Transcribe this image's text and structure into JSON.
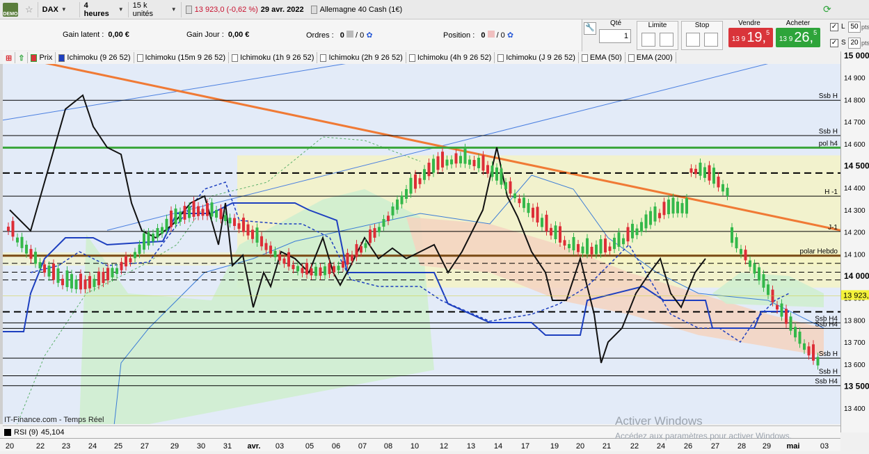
{
  "toolbar": {
    "demo_label": "DEMO",
    "instrument": "DAX",
    "timeframe": "4 heures",
    "units": "15 k unités",
    "quote": "13 923,0 (-0,62 %)",
    "date": "29 avr. 2022",
    "market": "Allemagne 40 Cash (1€)"
  },
  "stats": {
    "gain_latent_label": "Gain latent :",
    "gain_latent_value": "0,00 €",
    "gain_jour_label": "Gain Jour :",
    "gain_jour_value": "0,00 €",
    "ordres_label": "Ordres :",
    "ordres_value": "0",
    "ordres_slash": "/ 0",
    "position_label": "Position :",
    "position_value": "0",
    "position_slash": "/ 0"
  },
  "order_panel": {
    "qty_label": "Qté",
    "qty_value": "1",
    "limit_label": "Limite",
    "stop_label": "Stop",
    "sell_label": "Vendre",
    "buy_label": "Acheter",
    "sell_small": "13 9",
    "sell_big": "19,",
    "sell_sup": "5",
    "buy_small": "13 9",
    "buy_big": "26,",
    "buy_sup": "5",
    "l_label": "L",
    "l_value": "50",
    "s_label": "S",
    "s_value": "20",
    "unit": "pts",
    "sell_color": "#d9343a",
    "buy_color": "#2ea43a"
  },
  "legend": {
    "items": [
      "Prix",
      "Ichimoku (9 26 52)",
      "Ichimoku (15m 9 26 52)",
      "Ichimoku (1h 9 26 52)",
      "Ichimoku (2h 9 26 52)",
      "Ichimoku (4h 9 26 52)",
      "Ichimoku (J 9 26 52)",
      "EMA (50)",
      "EMA (200)"
    ]
  },
  "chart_data": {
    "type": "line",
    "title": "",
    "xlabel": "",
    "ylabel": "",
    "ylim": [
      13350,
      15000
    ],
    "y_ticks": [
      "15 000",
      "14 900",
      "14 800",
      "14 700",
      "14 600",
      "14 500",
      "14 400",
      "14 300",
      "14 200",
      "14 100",
      "14 000",
      "13 900",
      "13 800",
      "13 700",
      "13 600",
      "13 500",
      "13 400"
    ],
    "x_labels": [
      "20",
      "22",
      "23",
      "24",
      "25",
      "27",
      "29",
      "30",
      "31",
      "avr.",
      "03",
      "05",
      "06",
      "07",
      "08",
      "10",
      "12",
      "13",
      "14",
      "17",
      "19",
      "20",
      "21",
      "22",
      "24",
      "26",
      "27",
      "28",
      "29",
      "mai",
      "03"
    ],
    "last_price_label": "13 923,",
    "last_price": 13923,
    "horizontal_levels": [
      {
        "label": "Ssb H",
        "value": 14810
      },
      {
        "label": "Ssb H",
        "value": 14650
      },
      {
        "label": "pol h4",
        "value": 14595
      },
      {
        "label": "",
        "value": 14480
      },
      {
        "label": "H -1",
        "value": 14375
      },
      {
        "label": "J-1",
        "value": 14215
      },
      {
        "label": "polar Hebdo",
        "value": 14105
      },
      {
        "label": "",
        "value": 13850
      },
      {
        "label": "Ssb H4",
        "value": 13800
      },
      {
        "label": "Ssb H4",
        "value": 13775
      },
      {
        "label": "Ssb H",
        "value": 13640
      },
      {
        "label": "Ssb H",
        "value": 13560
      },
      {
        "label": "Ssb H4",
        "value": 13515
      }
    ]
  },
  "rsi": {
    "label": "RSI (9)",
    "value": "45,104"
  },
  "footer": {
    "source": "IT-Finance.com - Temps Réel",
    "watermark_title": "Activer Windows",
    "watermark_sub": "Accédez aux paramètres pour activer Windows."
  }
}
